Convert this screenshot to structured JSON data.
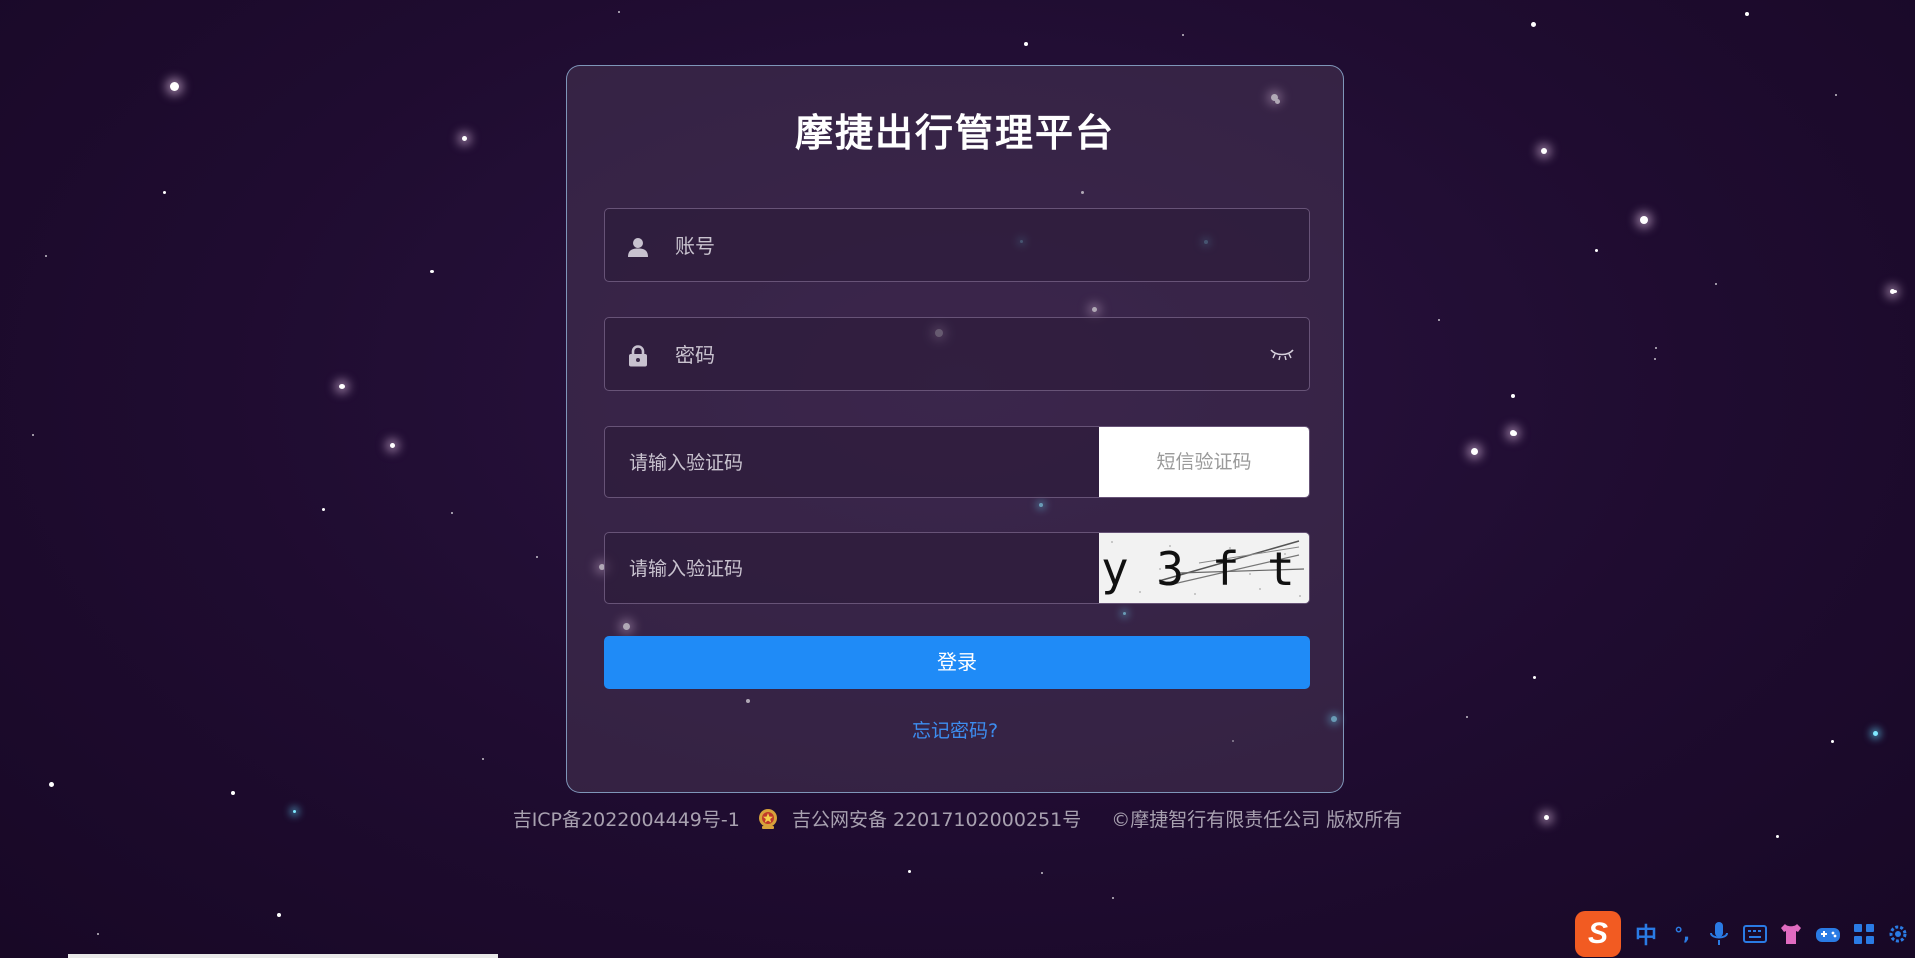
{
  "title": "摩捷出行管理平台",
  "form": {
    "account_placeholder": "账号",
    "password_placeholder": "密码",
    "sms_code_placeholder": "请输入验证码",
    "sms_button_label": "短信验证码",
    "captcha_placeholder": "请输入验证码",
    "captcha_text": "y 3 f t",
    "login_label": "登录",
    "forgot_label": "忘记密码?"
  },
  "footer": {
    "icp": "吉ICP备2022004449号-1",
    "police": "吉公网安备 22017102000251号",
    "copyright": "©摩捷智行有限责任公司 版权所有"
  },
  "ime": {
    "logo": "S",
    "mode": "中",
    "punct": "°,"
  },
  "colors": {
    "background": "#1e0d2e",
    "accent": "#1f8bf7",
    "link": "#3d8df0"
  }
}
